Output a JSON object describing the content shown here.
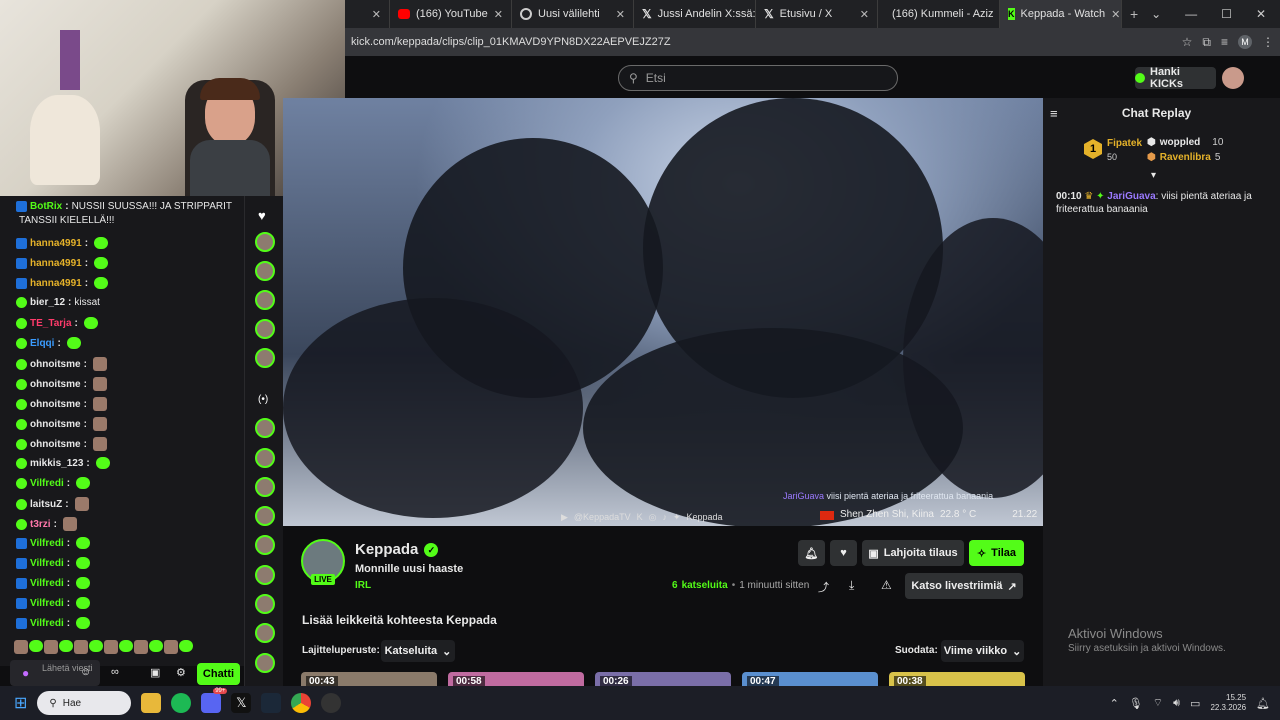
{
  "browser": {
    "tabs": [
      {
        "label": "",
        "icon": "close-icon"
      },
      {
        "label": "(166) YouTube",
        "icon": "youtube-icon"
      },
      {
        "label": "Uusi välilehti",
        "icon": "globe-icon"
      },
      {
        "label": "Jussi Andelin X:ssä: \"I",
        "icon": "x-icon"
      },
      {
        "label": "Etusivu / X",
        "icon": "x-icon"
      },
      {
        "label": "(166) Kummeli - Aziz",
        "icon": "youtube-icon"
      },
      {
        "label": "Keppada - Watch",
        "icon": "kick-icon",
        "active": true
      }
    ],
    "url": "kick.com/keppada/clips/clip_01KMAVD9YPN8DX22AEPVEJZ27Z",
    "profile_initial": "M"
  },
  "kick": {
    "search_placeholder": "Etsi",
    "get_kicks": "Hanki KICKs"
  },
  "video": {
    "chat_overlay_user": "JariGuava",
    "chat_overlay_text": "viisi pientä ateriaa ja friteerattua banaania",
    "socials_left": "@KeppadaTV",
    "socials_right": "Keppada",
    "location": "Shen Zhen Shi, Kiina",
    "temperature": "22.8 ° C",
    "time": "21.22"
  },
  "channel": {
    "name": "Keppada",
    "live_badge": "LIVE",
    "title": "Monnille uusi haaste",
    "category": "IRL",
    "views_count": "6",
    "views_label": "katseluita",
    "separator": "•",
    "posted": "1 minuutti sitten",
    "gift_sub": "Lahjoita tilaus",
    "subscribe": "Tilaa",
    "watch_live": "Katso livestriimiä",
    "more_clips": "Lisää leikkeitä kohteesta Keppada",
    "sort_label": "Lajitteluperuste:",
    "sort_value": "Katseluita",
    "filter_label": "Suodata:",
    "filter_value": "Viime viikko",
    "clips": [
      {
        "duration": "00:43"
      },
      {
        "duration": "00:58"
      },
      {
        "duration": "00:26"
      },
      {
        "duration": "00:47"
      },
      {
        "duration": "00:38"
      }
    ]
  },
  "replay": {
    "title": "Chat Replay",
    "leaders": [
      {
        "rank": "1",
        "name": "Fipatek",
        "amount": "50"
      },
      {
        "name": "woppled",
        "amount": "10"
      },
      {
        "name": "Ravenlibra",
        "amount": "5"
      }
    ],
    "message": {
      "time": "00:10",
      "user": "JariGuava",
      "text": "viisi pientä ateriaa ja friteerattua banaania"
    }
  },
  "left_chat": {
    "messages": [
      {
        "user": "BotRix",
        "text": "NUSSII SUUSSA!!! JA STRIPPARIT",
        "color": "#53fc18"
      },
      {
        "user": "",
        "text": "TANSSII KIELELLÄ!!!",
        "color": "#e8e8e8"
      },
      {
        "user": "hanna4991",
        "text": "",
        "color": "#e5b22a"
      },
      {
        "user": "hanna4991",
        "text": "",
        "color": "#e5b22a"
      },
      {
        "user": "hanna4991",
        "text": "",
        "color": "#e5b22a"
      },
      {
        "user": "bier_12",
        "text": "kissat",
        "color": "#e8e8e8"
      },
      {
        "user": "TE_Tarja",
        "text": "",
        "color": "#ff3b6b"
      },
      {
        "user": "Elqqi",
        "text": "",
        "color": "#3b9cff"
      },
      {
        "user": "ohnoitsme",
        "text": "",
        "color": "#e8e8e8"
      },
      {
        "user": "ohnoitsme",
        "text": "",
        "color": "#e8e8e8"
      },
      {
        "user": "ohnoitsme",
        "text": "",
        "color": "#e8e8e8"
      },
      {
        "user": "ohnoitsme",
        "text": "",
        "color": "#e8e8e8"
      },
      {
        "user": "ohnoitsme",
        "text": "",
        "color": "#e8e8e8"
      },
      {
        "user": "mikkis_123",
        "text": "",
        "color": "#e8e8e8"
      },
      {
        "user": "Vilfredi",
        "text": "",
        "color": "#53fc18"
      },
      {
        "user": "laitsuZ",
        "text": "",
        "color": "#e8e8e8"
      },
      {
        "user": "t3rzi",
        "text": "",
        "color": "#ff77aa"
      },
      {
        "user": "Vilfredi",
        "text": "",
        "color": "#53fc18"
      },
      {
        "user": "Vilfredi",
        "text": "",
        "color": "#53fc18"
      },
      {
        "user": "Vilfredi",
        "text": "",
        "color": "#53fc18"
      },
      {
        "user": "Vilfredi",
        "text": "",
        "color": "#53fc18"
      },
      {
        "user": "Vilfredi",
        "text": "",
        "color": "#53fc18"
      }
    ],
    "input_placeholder": "Lähetä viesti",
    "chat_button": "Chatti"
  },
  "windows": {
    "watermark_title": "Aktivoi Windows",
    "watermark_sub": "Siirry asetuksiin ja aktivoi Windows.",
    "search": "Hae",
    "clock_time": "15.25",
    "clock_date": "22.3.2026",
    "notif_badge": "99+"
  },
  "colors": {
    "accent": "#53fc18",
    "bg": "#0e0e10",
    "panel": "#18181b"
  }
}
